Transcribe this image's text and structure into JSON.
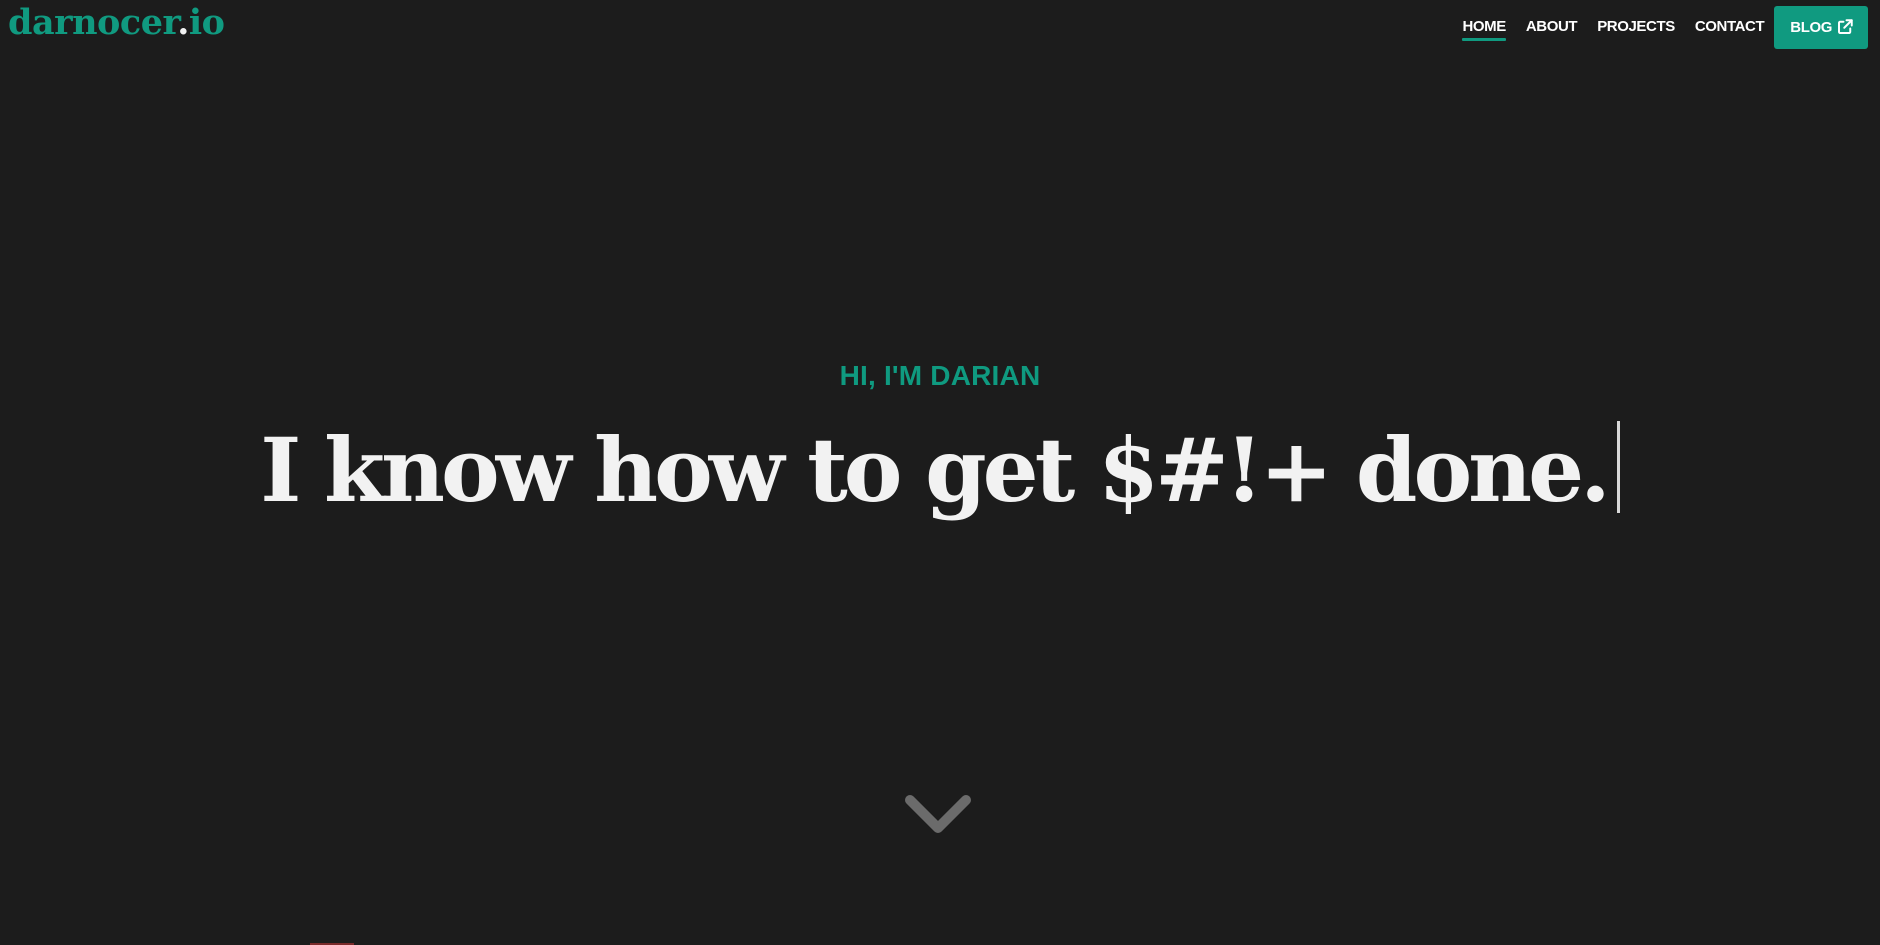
{
  "header": {
    "logo_main": "darnocer",
    "logo_dot": ".",
    "logo_tld": "io",
    "nav": [
      {
        "label": "HOME",
        "active": true
      },
      {
        "label": "ABOUT",
        "active": false
      },
      {
        "label": "PROJECTS",
        "active": false
      },
      {
        "label": "CONTACT",
        "active": false
      }
    ],
    "blog_label": "BLOG",
    "blog_icon": "external-link-icon"
  },
  "hero": {
    "greeting": "HI, I'M DARIAN",
    "headline": "I know how to get $#!+ done.",
    "scroll_icon": "chevron-down-icon"
  },
  "colors": {
    "accent": "#109a80",
    "background": "#1c1c1c",
    "text": "#f2f2f2",
    "chevron": "#6b6b6b"
  }
}
